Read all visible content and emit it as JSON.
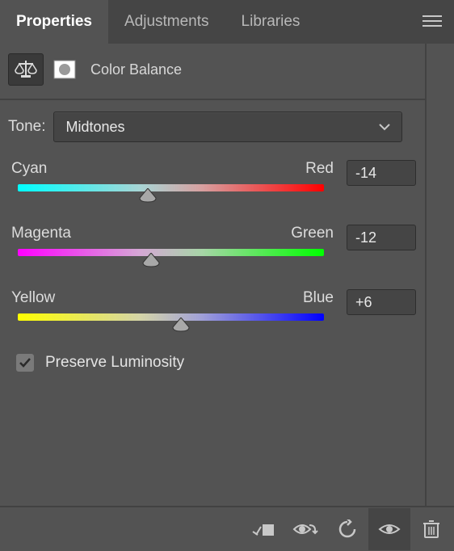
{
  "tabs": {
    "properties": "Properties",
    "adjustments": "Adjustments",
    "libraries": "Libraries"
  },
  "adjustment": {
    "title": "Color Balance"
  },
  "tone": {
    "label": "Tone:",
    "value": "Midtones"
  },
  "sliders": {
    "cyan_red": {
      "left": "Cyan",
      "right": "Red",
      "value": "-14",
      "percent": 43
    },
    "magenta_green": {
      "left": "Magenta",
      "right": "Green",
      "value": "-12",
      "percent": 44
    },
    "yellow_blue": {
      "left": "Yellow",
      "right": "Blue",
      "value": "+6",
      "percent": 53
    }
  },
  "preserve_luminosity": {
    "label": "Preserve Luminosity",
    "checked": true
  }
}
